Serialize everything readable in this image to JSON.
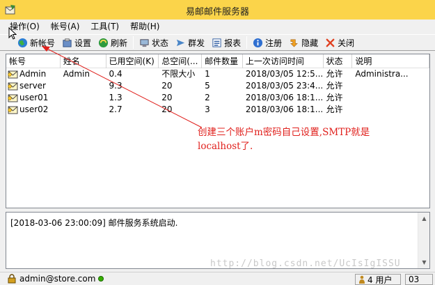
{
  "window": {
    "title": "易邮邮件服务器"
  },
  "menu": {
    "items": [
      "操作(O)",
      "帐号(A)",
      "工具(T)",
      "帮助(H)"
    ]
  },
  "toolbar": {
    "new_account": "新帐号",
    "settings": "设置",
    "refresh": "刷新",
    "status": "状态",
    "broadcast": "群发",
    "report": "报表",
    "register": "注册",
    "hide": "隐藏",
    "close": "关闭"
  },
  "grid": {
    "headers": [
      "帐号",
      "姓名",
      "已用空间(K)",
      "总空间(...",
      "邮件数量",
      "上一次访问时间",
      "状态",
      "说明"
    ],
    "rows": [
      [
        "Admin",
        "Admin",
        "0.4",
        "不限大小",
        "1",
        "2018/03/05 12:5...",
        "允许",
        "Administra..."
      ],
      [
        "server",
        "",
        "9.3",
        "20",
        "5",
        "2018/03/05 23:4...",
        "允许",
        ""
      ],
      [
        "user01",
        "",
        "1.3",
        "20",
        "2",
        "2018/03/06 18:1...",
        "允许",
        ""
      ],
      [
        "user02",
        "",
        "2.7",
        "20",
        "3",
        "2018/03/06 18:1...",
        "允许",
        ""
      ]
    ]
  },
  "log": {
    "line": "[2018-03-06 23:00:09] 邮件服务系统启动."
  },
  "annotation": {
    "line1": "创建三个账户m密码自己设置,SMTP就是",
    "line2": "localhost了."
  },
  "status": {
    "user": "admin@store.com",
    "count": "4 用户",
    "num": "03"
  },
  "watermark": "http://blog.csdn.net/UcIsIgISSU",
  "colors": {
    "titlebar": "#fbd44a",
    "annotation": "#e0201c"
  }
}
